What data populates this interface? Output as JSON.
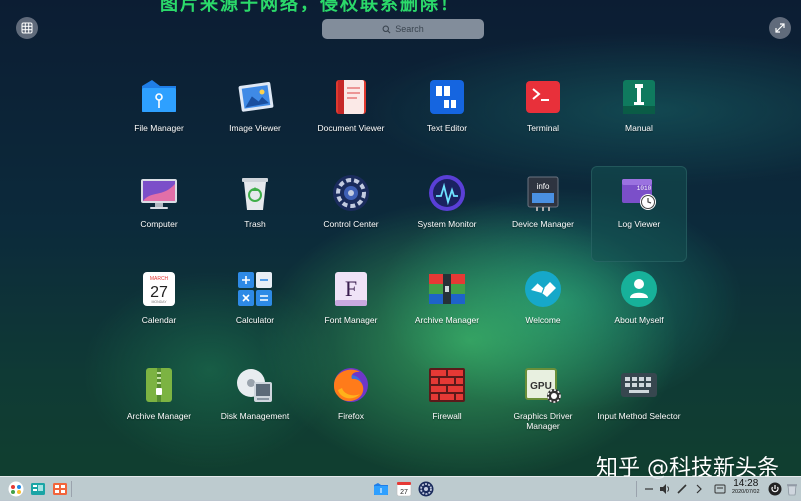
{
  "banner": {
    "text": "图片来源于网络，侵权联系删除！"
  },
  "search": {
    "placeholder": "Search"
  },
  "apps": [
    {
      "label": "File Manager",
      "icon": "file-manager-icon"
    },
    {
      "label": "Image Viewer",
      "icon": "image-viewer-icon"
    },
    {
      "label": "Document Viewer",
      "icon": "document-viewer-icon"
    },
    {
      "label": "Text Editor",
      "icon": "text-editor-icon"
    },
    {
      "label": "Terminal",
      "icon": "terminal-icon"
    },
    {
      "label": "Manual",
      "icon": "manual-icon"
    },
    {
      "label": "Computer",
      "icon": "computer-icon"
    },
    {
      "label": "Trash",
      "icon": "trash-icon"
    },
    {
      "label": "Control Center",
      "icon": "control-center-icon"
    },
    {
      "label": "System Monitor",
      "icon": "system-monitor-icon"
    },
    {
      "label": "Device Manager",
      "icon": "device-manager-icon"
    },
    {
      "label": "Log Viewer",
      "icon": "log-viewer-icon"
    },
    {
      "label": "Calendar",
      "icon": "calendar-icon",
      "month": "MARCH",
      "day": "27",
      "weekday": "MONDAY"
    },
    {
      "label": "Calculator",
      "icon": "calculator-icon"
    },
    {
      "label": "Font Manager",
      "icon": "font-manager-icon",
      "glyph": "F"
    },
    {
      "label": "Archive Manager",
      "icon": "archive-manager-icon"
    },
    {
      "label": "Welcome",
      "icon": "welcome-icon"
    },
    {
      "label": "About Myself",
      "icon": "about-myself-icon"
    },
    {
      "label": "Archive Manager",
      "icon": "archive-manager-green-icon"
    },
    {
      "label": "Disk Management",
      "icon": "disk-management-icon"
    },
    {
      "label": "Firefox",
      "icon": "firefox-icon"
    },
    {
      "label": "Firewall",
      "icon": "firewall-icon"
    },
    {
      "label": "Graphics Driver Manager",
      "icon": "graphics-driver-icon",
      "chip": "GPU"
    },
    {
      "label": "Input Method Selector",
      "icon": "input-method-icon"
    }
  ],
  "device_manager_badge": "info",
  "log_viewer_badge": "1010",
  "watermark": "知乎 @科技新头条",
  "dock": {
    "calendar_day": "27",
    "time": "14:28",
    "date": "2020/07/02"
  }
}
